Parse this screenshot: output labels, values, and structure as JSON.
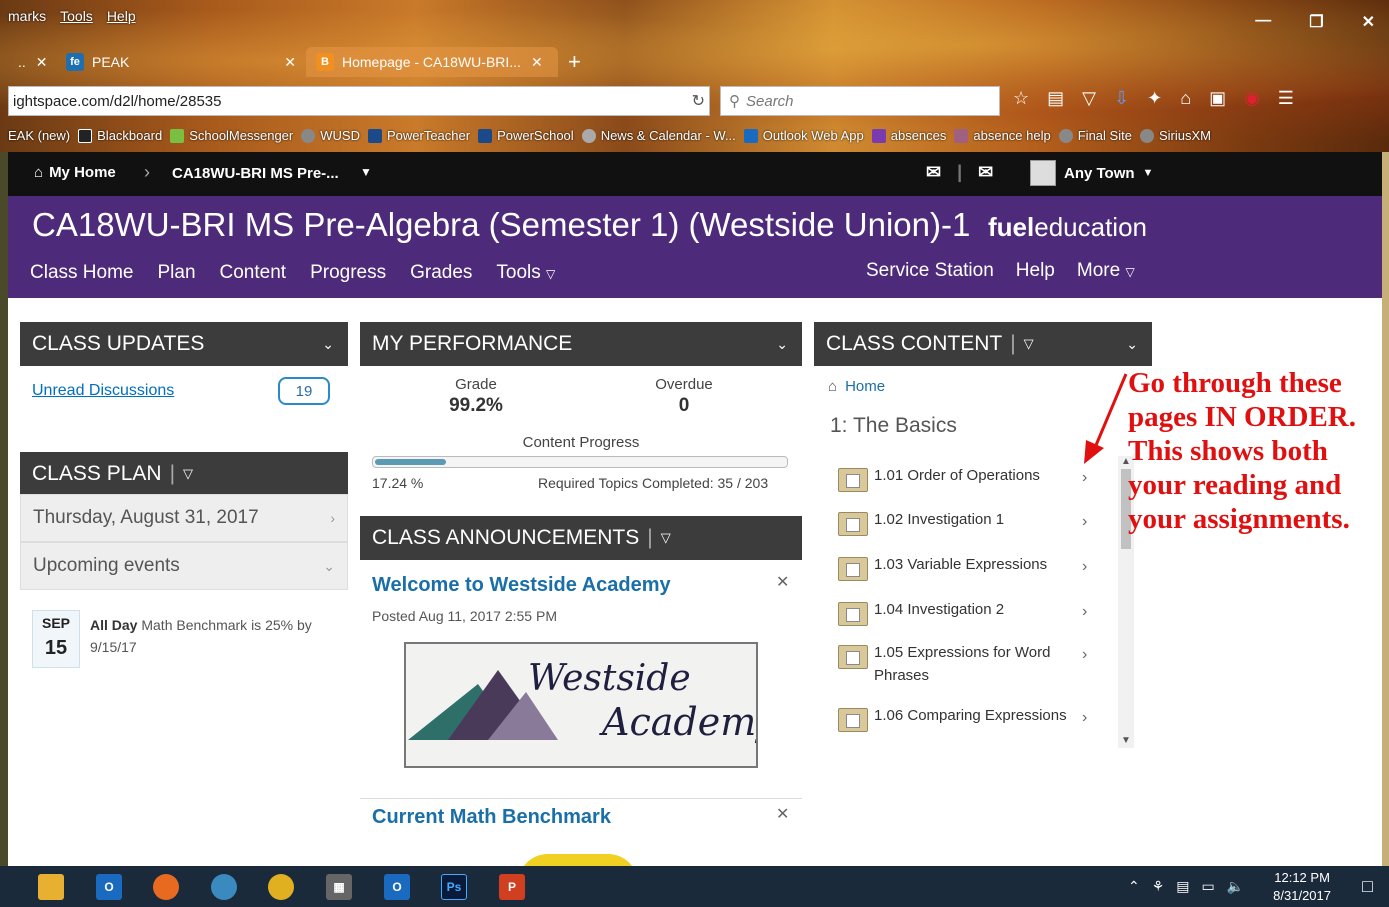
{
  "browser": {
    "menu": [
      "marks",
      "Tools",
      "Help"
    ],
    "tabs": [
      {
        "label": "PEAK",
        "icon": "fe"
      },
      {
        "label": "Homepage - CA18WU-BRI...",
        "icon": "B"
      }
    ],
    "url": "ightspace.com/d2l/home/28535",
    "search_placeholder": "Search",
    "bookmarks": [
      "EAK (new)",
      "Blackboard",
      "SchoolMessenger",
      "WUSD",
      "PowerTeacher",
      "PowerSchool",
      "News & Calendar - W...",
      "Outlook Web App",
      "absences",
      "absence help",
      "Final Site",
      "SiriusXM"
    ]
  },
  "d2l": {
    "my_home": "My Home",
    "course_short": "CA18WU-BRI MS Pre-...",
    "user": "Any Town"
  },
  "header": {
    "course_title": "CA18WU-BRI MS Pre-Algebra (Semester 1) (Westside Union)-1",
    "brand_bold": "fuel",
    "brand_rest": "education",
    "nav": [
      "Class Home",
      "Plan",
      "Content",
      "Progress",
      "Grades",
      "Tools"
    ],
    "nav_right": [
      "Service Station",
      "Help",
      "More"
    ]
  },
  "class_updates": {
    "title": "CLASS UPDATES",
    "unread_label": "Unread Discussions",
    "unread_count": "19"
  },
  "class_plan": {
    "title": "CLASS PLAN",
    "date": "Thursday, August 31, 2017",
    "upcoming": "Upcoming events",
    "event_month": "SEP",
    "event_day": "15",
    "event_when": "All Day",
    "event_text": "Math Benchmark is 25% by",
    "event_text2": "9/15/17"
  },
  "performance": {
    "title": "MY PERFORMANCE",
    "grade_label": "Grade",
    "grade_value": "99.2%",
    "overdue_label": "Overdue",
    "overdue_value": "0",
    "progress_label": "Content Progress",
    "progress_pct_text": "17.24 %",
    "progress_fraction": 0.1724,
    "required_text": "Required Topics Completed: 35 / 203"
  },
  "announcements": {
    "title": "CLASS ANNOUNCEMENTS",
    "items": [
      {
        "title": "Welcome to Westside Academy",
        "posted": "Posted Aug 11, 2017 2:55 PM"
      },
      {
        "title": "Current Math Benchmark"
      }
    ],
    "logo_text_1": "Westside",
    "logo_text_2": "Academy"
  },
  "class_content": {
    "title": "CLASS CONTENT",
    "home": "Home",
    "unit": "1: The Basics",
    "items": [
      "1.01 Order of Operations",
      "1.02 Investigation 1",
      "1.03 Variable Expressions",
      "1.04 Investigation 2",
      "1.05 Expressions for Word Phrases",
      "1.06 Comparing Expressions"
    ]
  },
  "annotation": {
    "lines": [
      "Go through these",
      "pages IN ORDER.",
      "This shows both",
      "your reading and",
      "your assignments."
    ],
    "color": "#e01010"
  },
  "taskbar": {
    "time": "12:12 PM",
    "date": "8/31/2017"
  }
}
